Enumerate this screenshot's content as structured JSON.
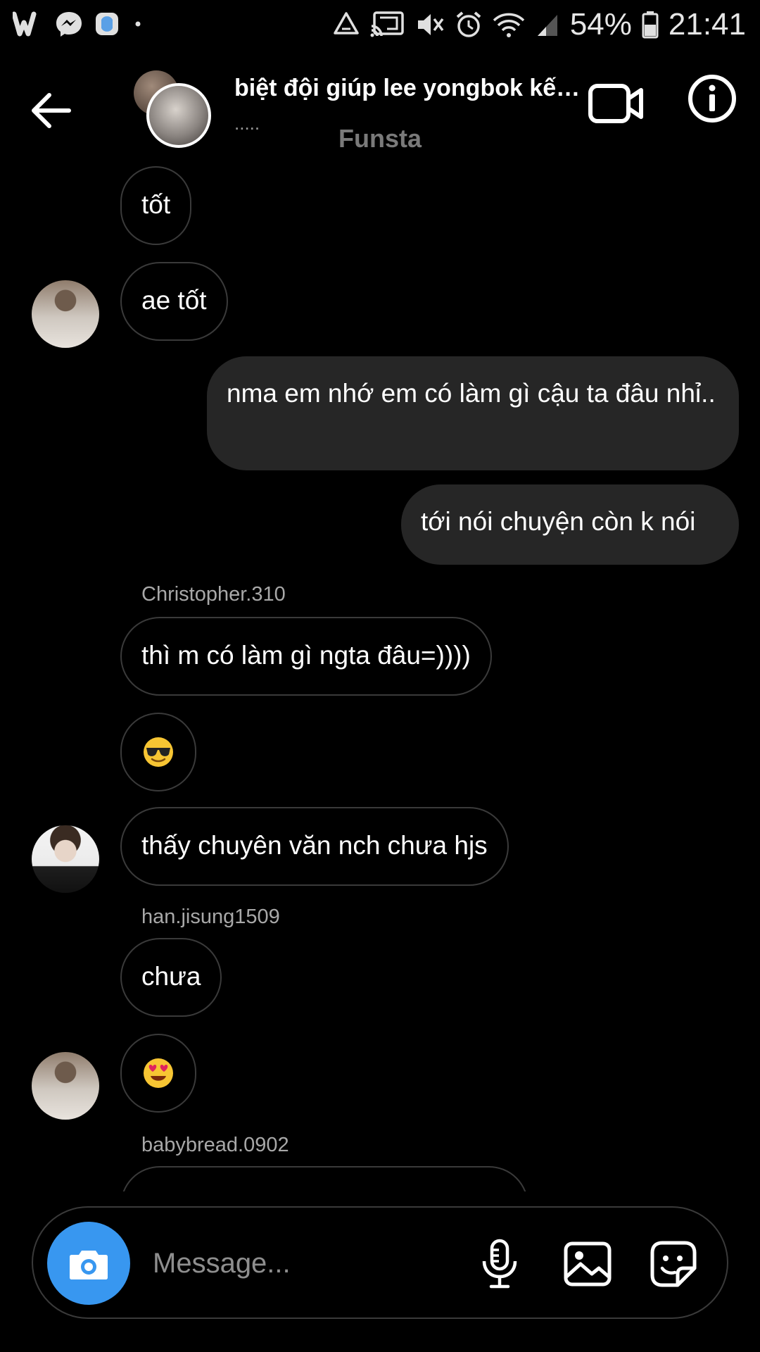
{
  "status_bar": {
    "battery": "54%",
    "time": "21:41",
    "icons": [
      "w-app-icon",
      "messenger-icon",
      "gallery-app-icon",
      "dot-icon",
      "recycle-icon",
      "cast-icon",
      "mute-icon",
      "alarm-icon",
      "wifi-icon",
      "signal-icon",
      "battery-icon"
    ]
  },
  "header": {
    "title": "biệt đội giúp lee yongbok kết ...",
    "subtitle": ".....",
    "label": "Funsta",
    "icons": [
      "back-arrow-icon",
      "video-call-icon",
      "info-icon"
    ]
  },
  "messages": [
    {
      "type": "incoming",
      "text": "tốt"
    },
    {
      "type": "incoming",
      "text": "ae tốt"
    },
    {
      "type": "outgoing",
      "text": "nma em nhớ em có làm gì cậu ta đâu nhỉ.."
    },
    {
      "type": "outgoing",
      "text": "tới nói chuyện còn k nói"
    },
    {
      "type": "sender",
      "text": "Christopher.310"
    },
    {
      "type": "incoming",
      "text": "thì m có làm gì ngta đâu=))))"
    },
    {
      "type": "incoming-emoji",
      "emoji": "😎",
      "icon": "sunglasses-emoji-icon"
    },
    {
      "type": "incoming",
      "text": "thấy chuyên văn nch chưa hjs"
    },
    {
      "type": "sender",
      "text": "han.jisung1509"
    },
    {
      "type": "incoming",
      "text": "chưa"
    },
    {
      "type": "incoming-emoji",
      "emoji": "😍",
      "icon": "heart-eyes-emoji-icon"
    },
    {
      "type": "sender",
      "text": "babybread.0902"
    }
  ],
  "composer": {
    "placeholder": "Message...",
    "icons": [
      "camera-icon",
      "microphone-icon",
      "gallery-icon",
      "sticker-icon"
    ]
  },
  "colors": {
    "background": "#000000",
    "outgoing_bubble": "#262626",
    "incoming_border": "#3a3a3a",
    "camera_button": "#3897f0",
    "muted_text": "#a8a8a8"
  }
}
